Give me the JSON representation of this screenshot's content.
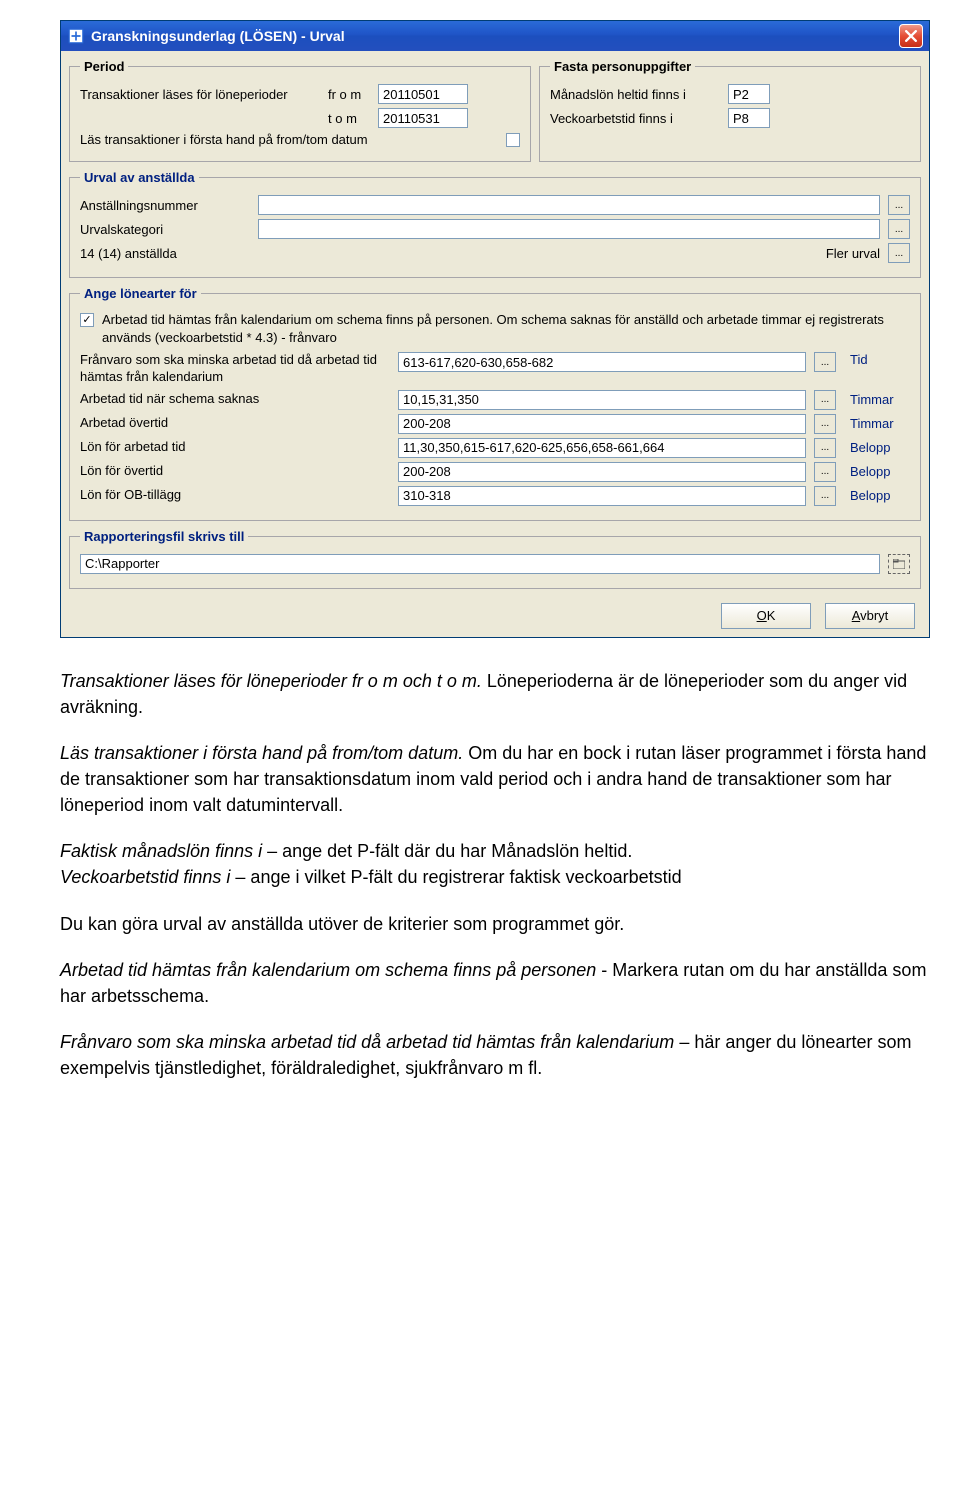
{
  "window": {
    "title": "Granskningsunderlag (LÖSEN) - Urval"
  },
  "period": {
    "legend": "Period",
    "trans_label": "Transaktioner läses för löneperioder",
    "from_label": "fr o m",
    "from_value": "20110501",
    "to_label": "t o m",
    "to_value": "20110531",
    "read_first_hand_label": "Läs transaktioner i första hand på from/tom datum"
  },
  "fasta": {
    "legend": "Fasta personuppgifter",
    "manadslon_label": "Månadslön heltid finns i",
    "manadslon_value": "P2",
    "vecko_label": "Veckoarbetstid finns i",
    "vecko_value": "P8"
  },
  "urval": {
    "legend": "Urval av anställda",
    "anst_label": "Anställningsnummer",
    "kategori_label": "Urvalskategori",
    "count_label": "14 (14) anställda",
    "fler_label": "Fler urval"
  },
  "lonearter": {
    "legend": "Ange lönearter för",
    "checkbox_text": "Arbetad tid hämtas från kalendarium om schema finns på personen. Om schema saknas för anställd och arbetade timmar ej registrerats används (veckoarbetstid * 4.3) - frånvaro",
    "rows": {
      "franvaro": {
        "label": "Frånvaro som ska minska arbetad tid då arbetad tid hämtas från kalendarium",
        "value": "613-617,620-630,658-682",
        "unit": "Tid"
      },
      "schema_saknas": {
        "label": "Arbetad tid när schema saknas",
        "value": "10,15,31,350",
        "unit": "Timmar"
      },
      "overtid": {
        "label": "Arbetad övertid",
        "value": "200-208",
        "unit": "Timmar"
      },
      "lon_arbetad": {
        "label": "Lön för arbetad tid",
        "value": "11,30,350,615-617,620-625,656,658-661,664",
        "unit": "Belopp"
      },
      "lon_overtid": {
        "label": "Lön för övertid",
        "value": "200-208",
        "unit": "Belopp"
      },
      "lon_ob": {
        "label": "Lön för OB-tillägg",
        "value": "310-318",
        "unit": "Belopp"
      }
    }
  },
  "rapport": {
    "legend": "Rapporteringsfil skrivs till",
    "path": "C:\\Rapporter"
  },
  "buttons": {
    "ok_u": "O",
    "ok_rest": "K",
    "cancel_u": "A",
    "cancel_rest": "vbryt"
  },
  "doc": {
    "p1a": "Transaktioner läses för löneperioder fr o m och t o m.",
    "p1b": " Löneperioderna är de löneperioder som du anger vid avräkning.",
    "p2a": "Läs transaktioner i första hand på from/tom datum.",
    "p2b": " Om du har en bock i rutan läser programmet i första hand de transaktioner som har transaktionsdatum inom vald period och i andra hand de transaktioner som har löneperiod inom valt datumintervall.",
    "p3a": "Faktisk månadslön finns i",
    "p3b": " – ange det P-fält där du har Månadslön heltid.",
    "p3c": "Veckoarbetstid finns i",
    "p3d": " – ange i vilket P-fält du registrerar faktisk veckoarbetstid",
    "p4": "Du kan göra urval av anställda utöver de kriterier som programmet gör.",
    "p5a": "Arbetad tid hämtas från kalendarium om schema finns på personen",
    "p5b": " - Markera rutan om du har anställda som har arbetsschema.",
    "p6a": "Frånvaro som ska minska arbetad tid då arbetad tid hämtas från kalendarium",
    "p6b": " – här anger du  lönearter som exempelvis tjänstledighet, föräldraledighet, sjukfrånvaro m fl."
  }
}
